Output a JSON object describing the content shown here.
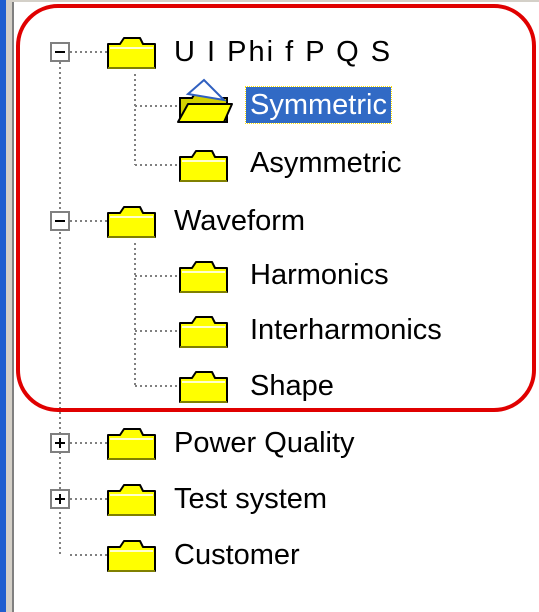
{
  "tree": {
    "groups": [
      {
        "label": "U I Phi f P Q S",
        "expanded": true,
        "children": [
          {
            "label": "Symmetric",
            "selected": true
          },
          {
            "label": "Asymmetric",
            "selected": false
          }
        ]
      },
      {
        "label": "Waveform",
        "expanded": true,
        "children": [
          {
            "label": "Harmonics",
            "selected": false
          },
          {
            "label": "Interharmonics",
            "selected": false
          },
          {
            "label": "Shape",
            "selected": false
          }
        ]
      },
      {
        "label": "Power Quality",
        "expanded": false,
        "children": []
      },
      {
        "label": "Test system",
        "expanded": false,
        "children": []
      },
      {
        "label": "Customer",
        "expanded": false,
        "children": []
      }
    ]
  },
  "icons": {
    "folder": "folder-icon",
    "open_folder": "open-folder-icon",
    "expand": "plus-box-icon",
    "collapse": "minus-box-icon"
  },
  "colors": {
    "selection_bg": "#316ac5",
    "selection_text": "#ffffff",
    "highlight_outline": "#e00000",
    "folder_fill": "#ffff00",
    "window_edge": "#1f5ed0"
  }
}
